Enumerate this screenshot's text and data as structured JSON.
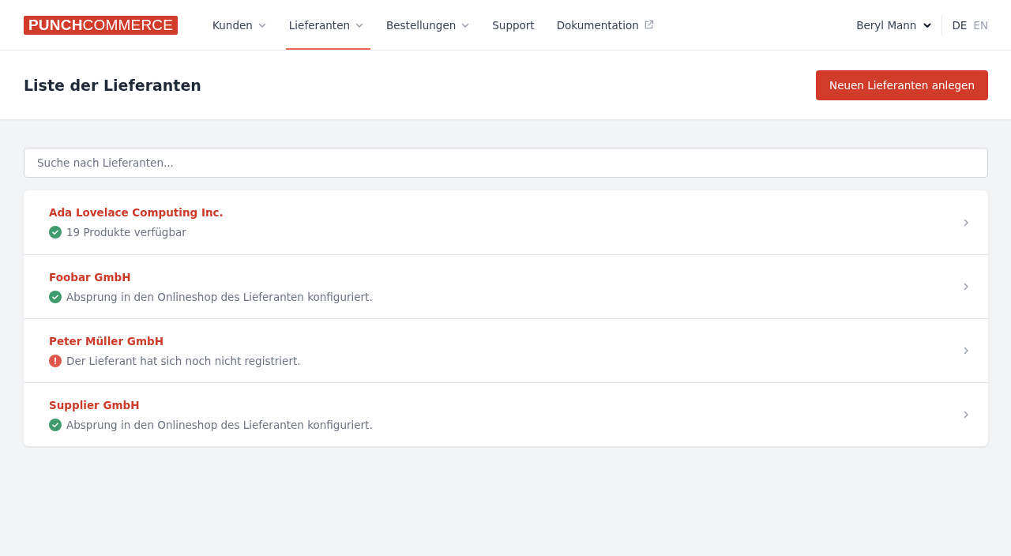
{
  "logo": "**PUNCH**COMMERCE",
  "nav": [
    {
      "label": "Kunden",
      "kind": "dropdown",
      "selected": false
    },
    {
      "label": "Lieferanten",
      "kind": "dropdown",
      "selected": true
    },
    {
      "label": "Bestellungen",
      "kind": "dropdown",
      "selected": false
    },
    {
      "label": "Support",
      "kind": "plain",
      "selected": false
    },
    {
      "label": "Dokumentation",
      "kind": "external",
      "selected": false
    }
  ],
  "user": "Beryl Mann",
  "languages": [
    {
      "label": "DE",
      "selected": true
    },
    {
      "label": "EN",
      "selected": false
    }
  ],
  "page_title": "Liste der Lieferanten",
  "primary_button": "Neuen Lieferanten anlegen",
  "search": {
    "placeholder": "Suche nach Lieferanten..."
  },
  "suppliers": [
    {
      "name": "Ada Lovelace Computing Inc.",
      "kind": "ok",
      "message": "19 Produkte verfügbar"
    },
    {
      "name": "Foobar GmbH",
      "kind": "ok",
      "message": "Absprung in den Onlineshop des Lieferanten konfiguriert."
    },
    {
      "name": "Peter Müller GmbH",
      "kind": "error",
      "message": "Der Lieferant hat sich noch nicht registriert."
    },
    {
      "name": "Supplier GmbH",
      "kind": "ok",
      "message": "Absprung in den Onlineshop des Lieferanten konfiguriert."
    }
  ]
}
